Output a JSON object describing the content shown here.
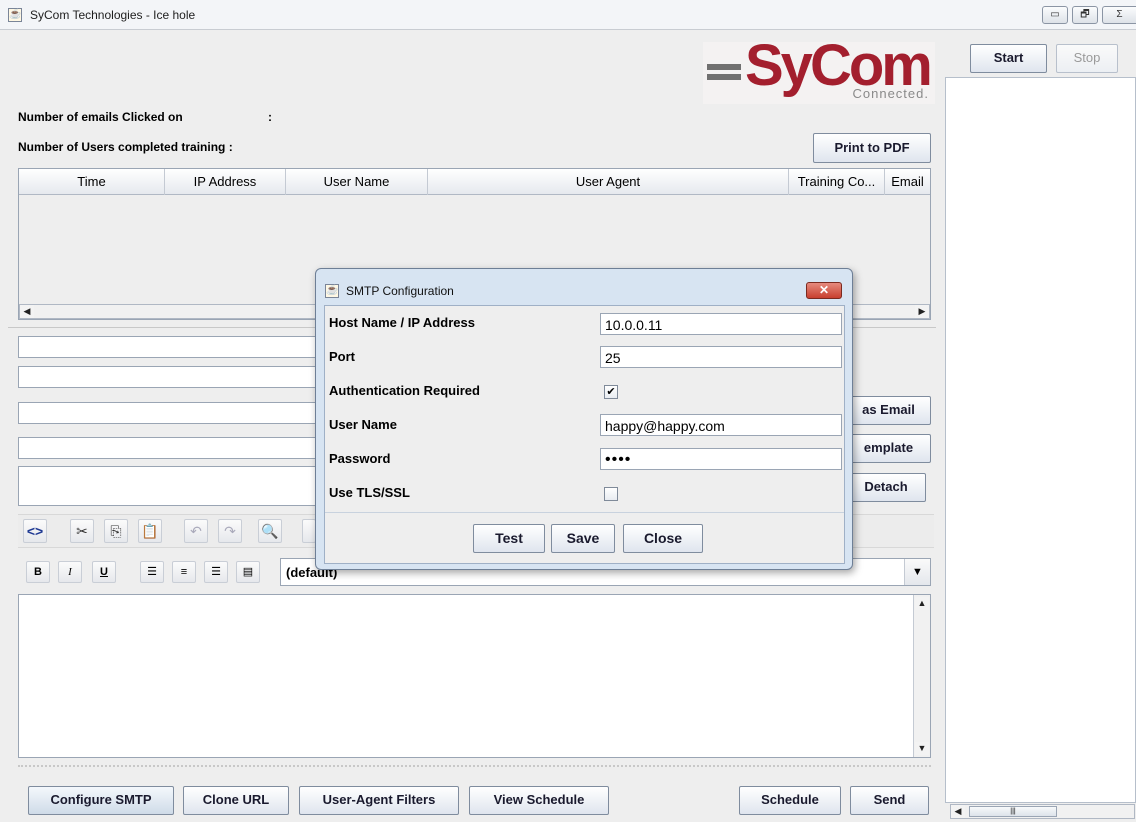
{
  "window": {
    "title": "SyCom Technologies - Ice hole",
    "controls": {
      "minimize": "▭",
      "maximize": "🗗",
      "close": "Σ"
    }
  },
  "logo": {
    "word": "SyCom",
    "tagline": "Connected."
  },
  "stats": {
    "clicked_label": "Number of emails Clicked on",
    "clicked_colon": ":",
    "completed_label": "Number of Users completed training :"
  },
  "buttons": {
    "print_pdf": "Print to PDF",
    "start": "Start",
    "stop": "Stop",
    "as_email": "as Email",
    "template": "emplate",
    "detach": "Detach",
    "configure_smtp": "Configure SMTP",
    "clone_url": "Clone URL",
    "user_agent_filters": "User-Agent Filters",
    "view_schedule": "View Schedule",
    "schedule": "Schedule",
    "send": "Send"
  },
  "table": {
    "columns": [
      "Time",
      "IP Address",
      "User Name",
      "User Agent",
      "Training Co...",
      "Email"
    ]
  },
  "formatting": {
    "bold": "B",
    "italic": "I",
    "underline": "U",
    "font_select": "(default)"
  },
  "dialog": {
    "title": "SMTP Configuration",
    "host_label": "Host Name / IP Address",
    "host_value": "10.0.0.11",
    "port_label": "Port",
    "port_value": "25",
    "auth_label": "Authentication Required",
    "auth_checked": true,
    "user_label": "User Name",
    "user_value": "happy@happy.com",
    "password_label": "Password",
    "password_value": "••••",
    "tls_label": "Use TLS/SSL",
    "tls_checked": false,
    "test": "Test",
    "save": "Save",
    "close": "Close"
  },
  "colors": {
    "brand_red": "#a31f2e",
    "dialog_frame": "#d7e4f2"
  }
}
